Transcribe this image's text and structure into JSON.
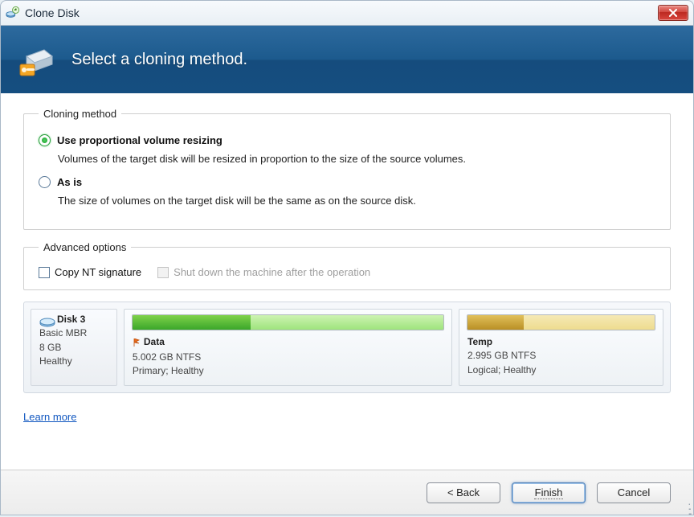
{
  "window": {
    "title": "Clone Disk"
  },
  "header": {
    "title": "Select a cloning method."
  },
  "cloning_method": {
    "legend": "Cloning method",
    "option1": {
      "label": "Use proportional volume resizing",
      "desc": "Volumes of the target disk will be resized in proportion to the size of the source volumes.",
      "selected": true
    },
    "option2": {
      "label": "As is",
      "desc": "The size of volumes on the target disk will be the same as on the source disk.",
      "selected": false
    }
  },
  "advanced": {
    "legend": "Advanced options",
    "copy_nt": {
      "label": "Copy NT signature",
      "checked": false,
      "enabled": true
    },
    "shutdown": {
      "label": "Shut down the machine after the operation",
      "checked": false,
      "enabled": false
    }
  },
  "disk": {
    "name": "Disk 3",
    "scheme": "Basic MBR",
    "size": "8 GB",
    "status": "Healthy",
    "partitions": [
      {
        "name": "Data",
        "size": "5.002 GB NTFS",
        "status": "Primary; Healthy"
      },
      {
        "name": "Temp",
        "size": "2.995 GB NTFS",
        "status": "Logical; Healthy"
      }
    ]
  },
  "link": {
    "learn_more": "Learn more"
  },
  "buttons": {
    "back": "< Back",
    "finish": "Finish",
    "cancel": "Cancel"
  }
}
